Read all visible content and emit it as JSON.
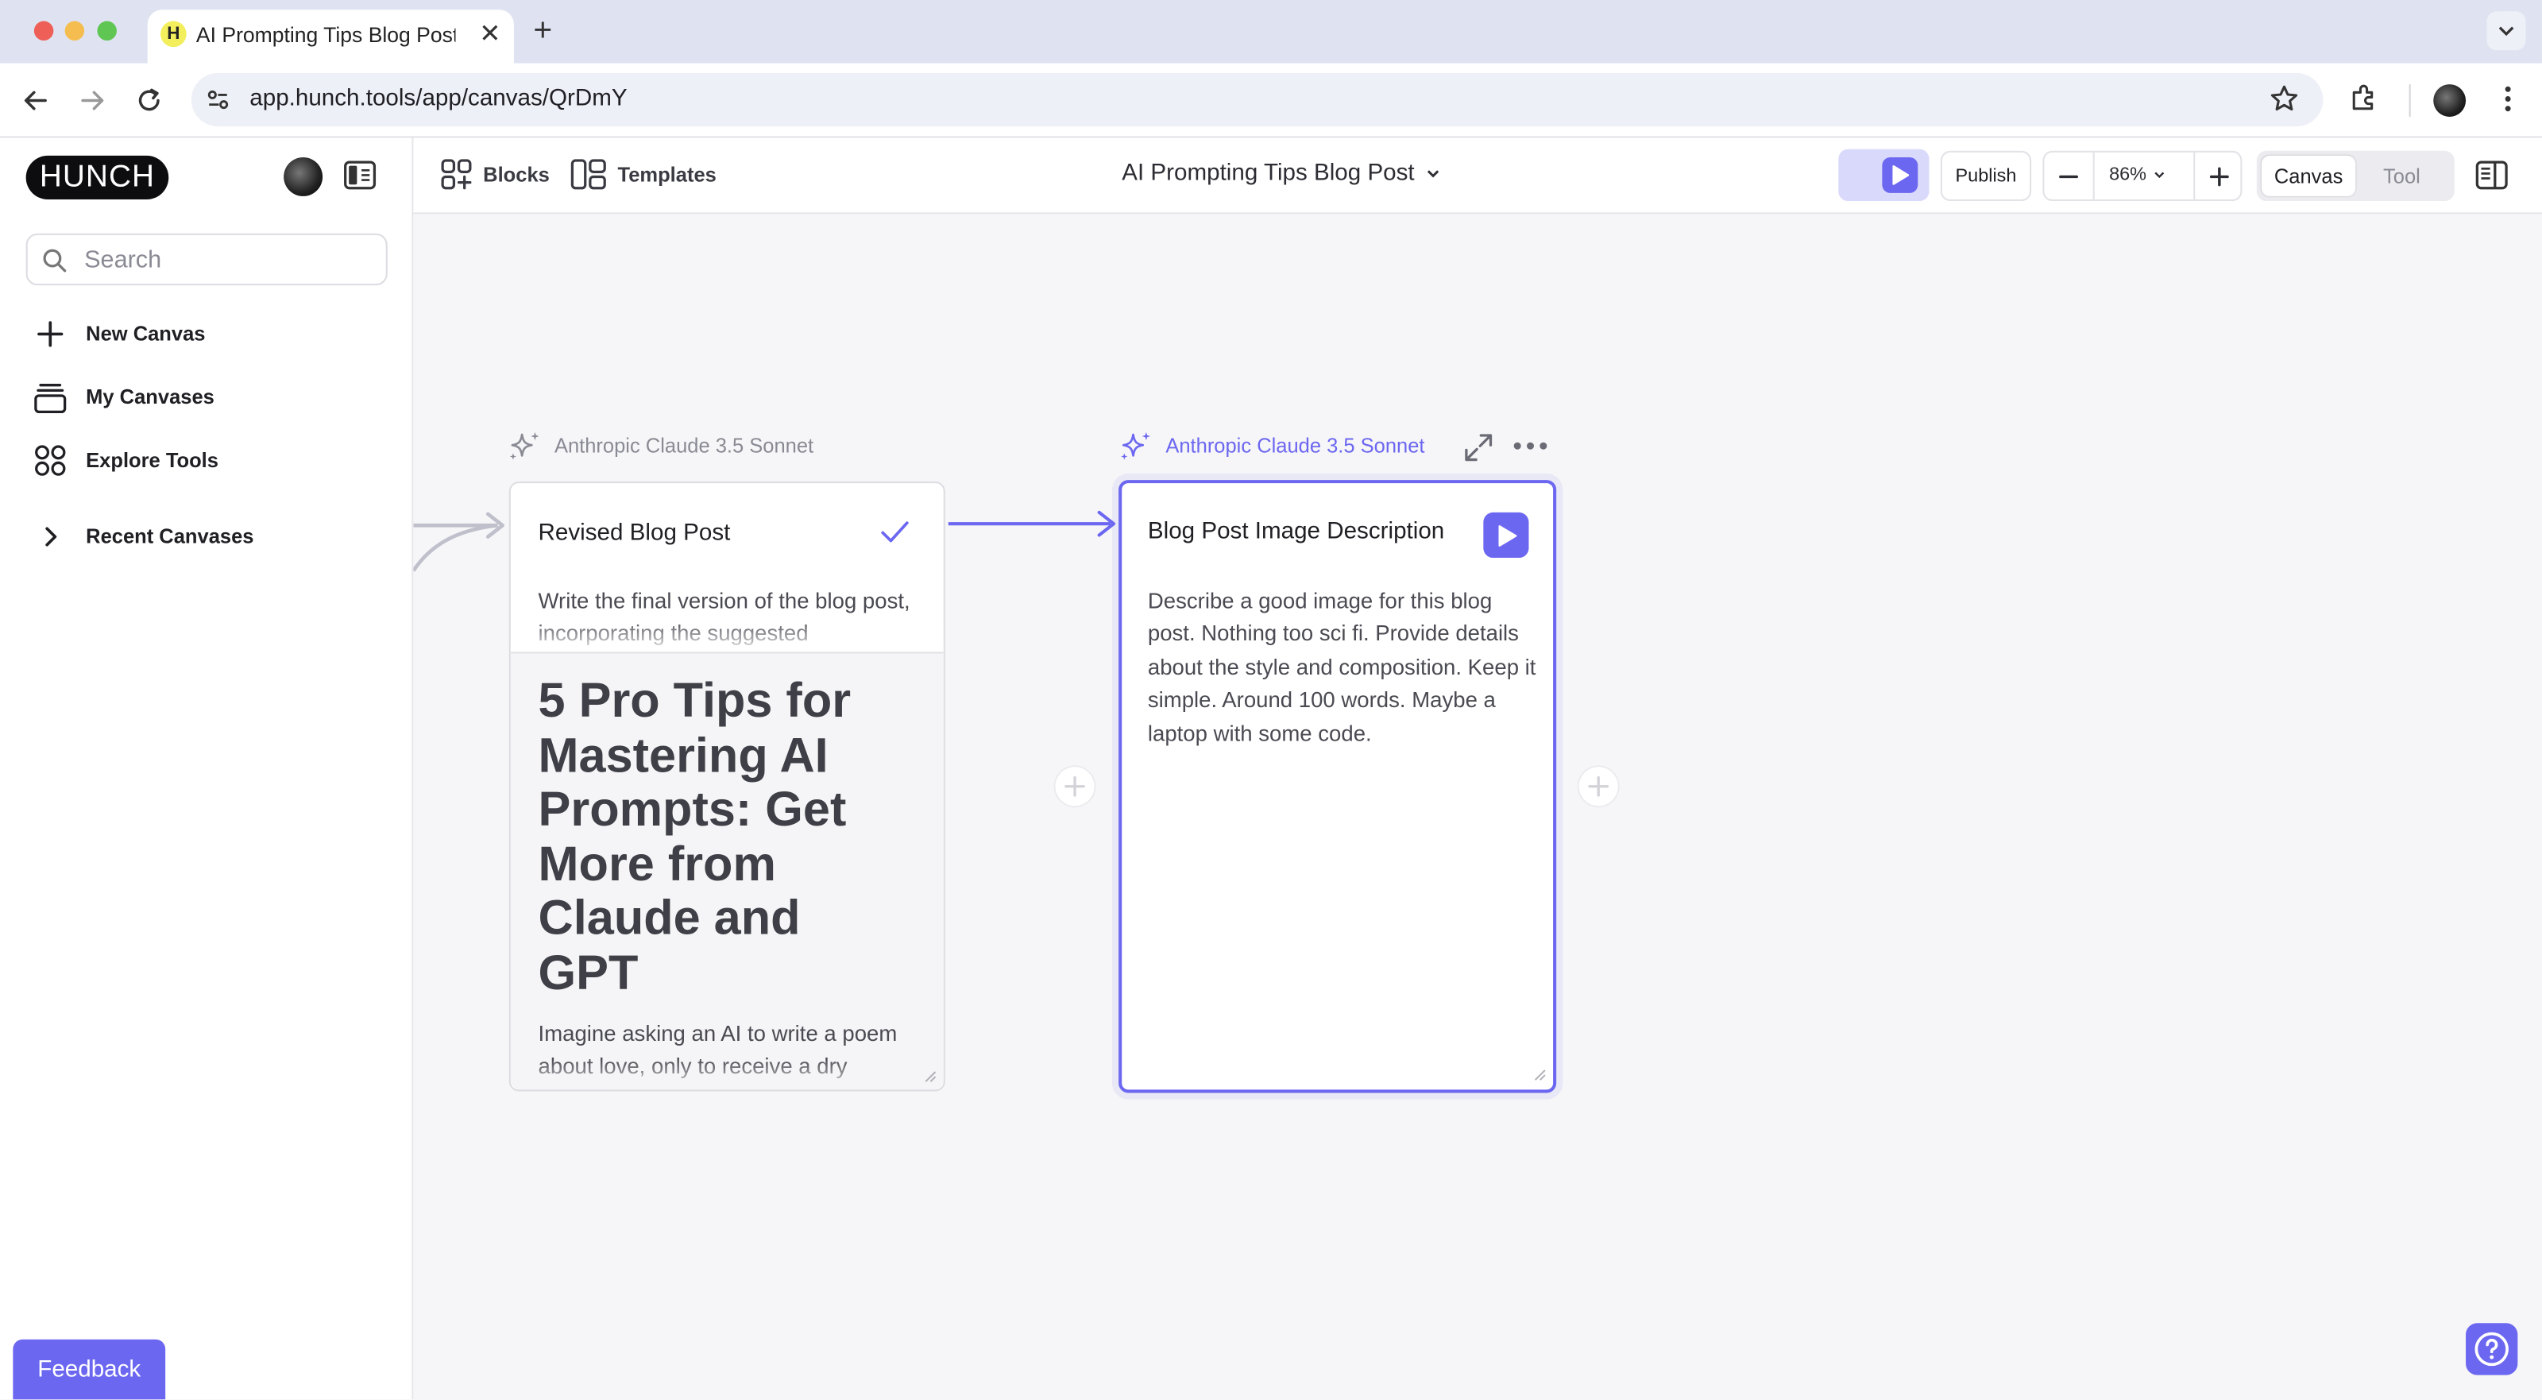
{
  "browser": {
    "tab_title": "AI Prompting Tips Blog Post |",
    "tab_favicon_letter": "H",
    "url": "app.hunch.tools/app/canvas/QrDmY"
  },
  "sidebar": {
    "logo": "HUNCH",
    "search_placeholder": "Search",
    "items": [
      {
        "label": "New Canvas",
        "icon": "plus-icon"
      },
      {
        "label": "My Canvases",
        "icon": "stack-icon"
      },
      {
        "label": "Explore Tools",
        "icon": "grid-icon"
      },
      {
        "label": "Recent Canvases",
        "icon": "chevron-right-icon"
      }
    ],
    "feedback": "Feedback"
  },
  "header": {
    "blocks": "Blocks",
    "templates": "Templates",
    "canvas_title": "AI Prompting Tips Blog Post",
    "publish": "Publish",
    "zoom": "86%",
    "mode_canvas": "Canvas",
    "mode_tool": "Tool"
  },
  "canvas": {
    "nodes": [
      {
        "model": "Anthropic Claude 3.5 Sonnet",
        "title": "Revised Blog Post",
        "status": "complete",
        "prompt": "Write the final version of the blog post, incorporating the suggested",
        "output_heading": "5 Pro Tips for Mastering AI Prompts: Get More from Claude and GPT",
        "output_body": "Imagine asking an AI to write a poem about love, only to receive a dry"
      },
      {
        "model": "Anthropic Claude 3.5 Sonnet",
        "title": "Blog Post Image Description",
        "status": "ready",
        "prompt": "Describe a good image for this blog post. Nothing too sci fi. Provide details about the style and composition. Keep it simple. Around 100 words. Maybe a laptop with some code."
      }
    ]
  },
  "colors": {
    "accent": "#6c67f0",
    "canvas_bg": "#f6f6f8",
    "tab_strip": "#dfe3f1"
  }
}
